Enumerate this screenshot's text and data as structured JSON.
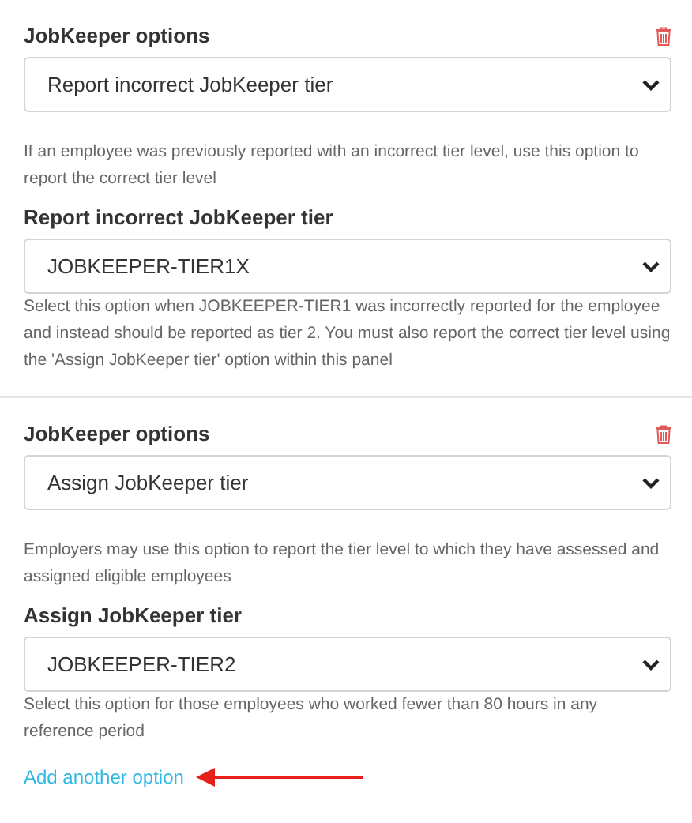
{
  "option_panels": [
    {
      "title": "JobKeeper options",
      "option_value": "Report incorrect JobKeeper tier",
      "option_help": "If an employee was previously reported with an incorrect tier level, use this option to report the correct tier level",
      "tier_label": "Report incorrect JobKeeper tier",
      "tier_value": "JOBKEEPER-TIER1X",
      "tier_help": "Select this option when JOBKEEPER-TIER1 was incorrectly reported for the employee and instead should be reported as tier 2. You must also report the correct tier level using the 'Assign JobKeeper tier' option within this panel"
    },
    {
      "title": "JobKeeper options",
      "option_value": "Assign JobKeeper tier",
      "option_help": "Employers may use this option to report the tier level to which they have assessed and assigned eligible employees",
      "tier_label": "Assign JobKeeper tier",
      "tier_value": "JOBKEEPER-TIER2",
      "tier_help": "Select this option for those employees who worked fewer than 80 hours in any reference period"
    }
  ],
  "add_link": "Add another option"
}
